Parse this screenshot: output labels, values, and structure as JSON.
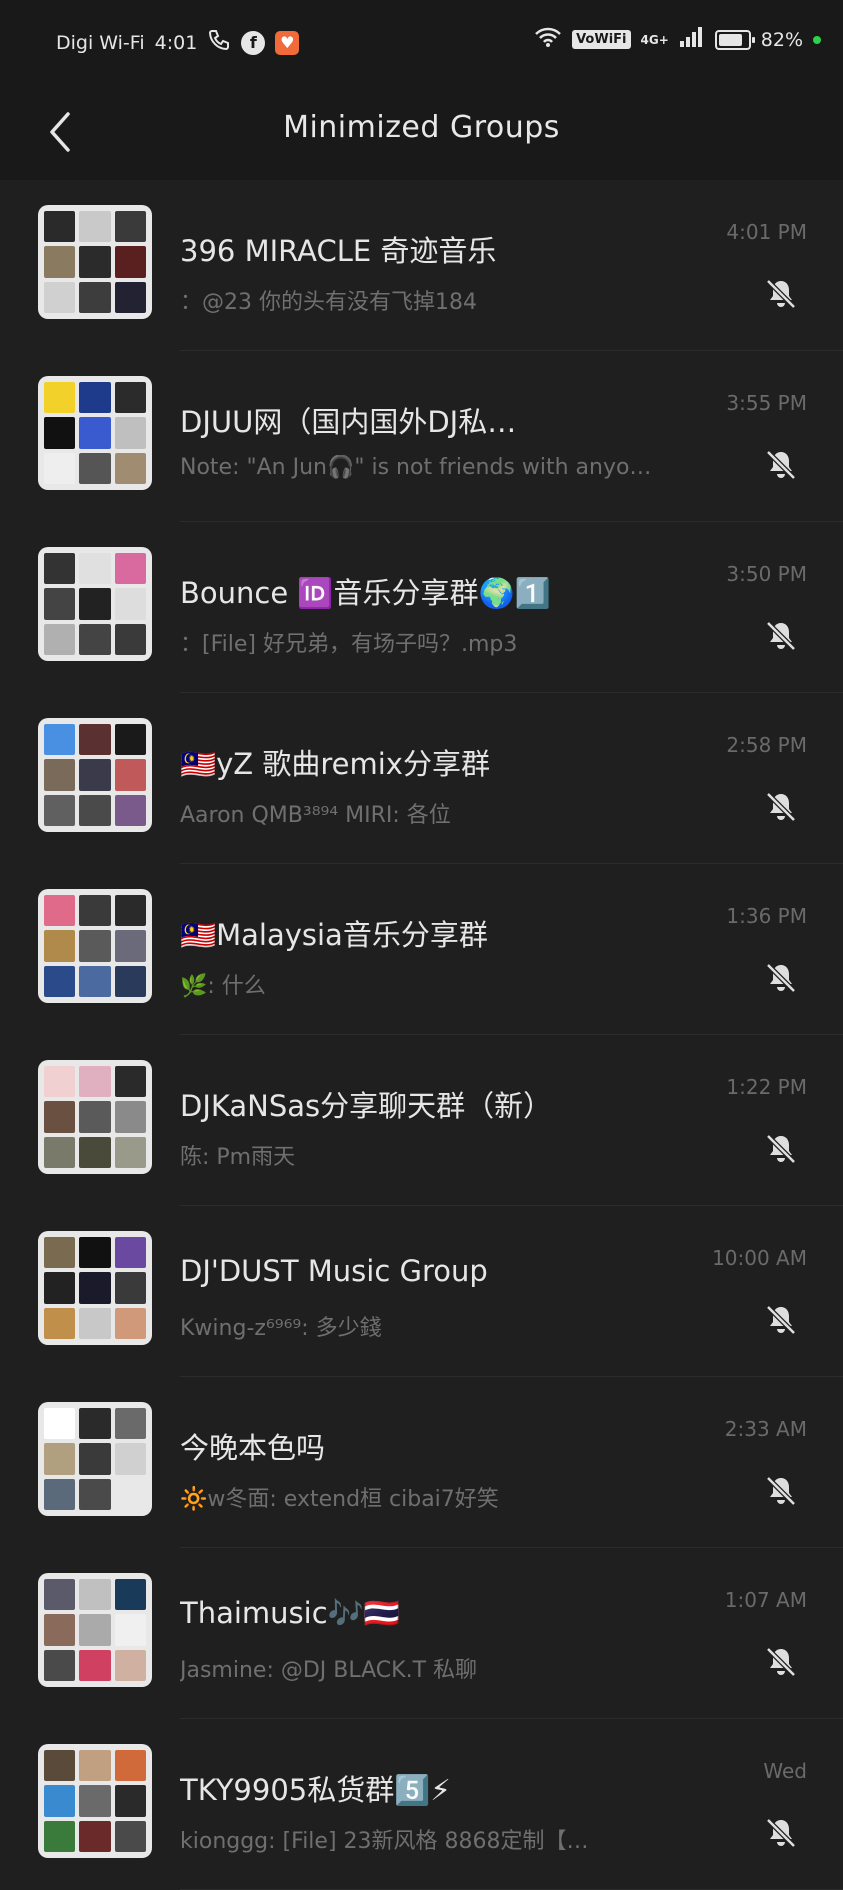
{
  "status_bar": {
    "carrier": "Digi Wi-Fi",
    "time": "4:01",
    "vowifi": "VoWiFi",
    "network": "4G+",
    "battery_percent": "82%",
    "battery_level": 0.82
  },
  "header": {
    "title": "Minimized Groups"
  },
  "groups": [
    {
      "name": "396 MIRACLE 奇迹音乐",
      "preview": "：@23 你的头有没有飞掉184",
      "time": "4:01 PM",
      "avatar_colors": [
        "#2a2a2a",
        "#c9c9c9",
        "#3a3a3a",
        "#8a7a60",
        "#2b2b2b",
        "#5a2020",
        "#d0d0d0",
        "#3d3d3d",
        "#222233"
      ]
    },
    {
      "name": "DJUU网（国内国外DJ私…",
      "preview": "Note: \"An Jun🎧\" is not friends with anyo…",
      "time": "3:55 PM",
      "avatar_colors": [
        "#f2d12a",
        "#1e3a8a",
        "#2b2b2b",
        "#111111",
        "#3a5bd0",
        "#bfbfbf",
        "#eeeeee",
        "#555555",
        "#a08c70"
      ]
    },
    {
      "name": "Bounce 🆔音乐分享群🌍1️⃣",
      "preview": "：[File] 好兄弟，有场子吗？.mp3",
      "time": "3:50 PM",
      "avatar_colors": [
        "#333333",
        "#e0e0e0",
        "#d86aa0",
        "#444444",
        "#222222",
        "#dddddd",
        "#b0b0b0",
        "#444444",
        "#3a3a3a"
      ]
    },
    {
      "name": "🇲🇾yZ 歌曲remix分享群",
      "preview": "Aaron QMB³⁸⁹⁴ MIRI: 各位",
      "time": "2:58 PM",
      "avatar_colors": [
        "#4a90e2",
        "#5a3030",
        "#1a1a1a",
        "#7a6a5a",
        "#3a3a4a",
        "#c05a5a",
        "#606060",
        "#4a4a4a",
        "#7a5a8a"
      ]
    },
    {
      "name": "🇲🇾Malaysia音乐分享群",
      "preview": "🌿: 什么",
      "time": "1:36 PM",
      "avatar_colors": [
        "#e06a8a",
        "#3a3a3a",
        "#2a2a2a",
        "#b08a4a",
        "#5a5a5a",
        "#6a6a7a",
        "#2a4a8a",
        "#4a6aa0",
        "#2a3a5a"
      ]
    },
    {
      "name": "DJKaNSas分享聊天群（新）",
      "preview": "陈: Pm雨天",
      "time": "1:22 PM",
      "avatar_colors": [
        "#f0d0d0",
        "#e0b0c0",
        "#2a2a2a",
        "#6a5040",
        "#5a5a5a",
        "#8a8a8a",
        "#7a7a6a",
        "#4a4a3a",
        "#9a9a8a"
      ]
    },
    {
      "name": "DJ'DUST Music Group",
      "preview": "Kwing-z⁶⁹⁶⁹: 多少錢",
      "time": "10:00 AM",
      "avatar_colors": [
        "#7a6a50",
        "#111111",
        "#6a4aa0",
        "#222222",
        "#1a1a2a",
        "#3a3a3a",
        "#c0904a",
        "#c8c8c8",
        "#d09a7a"
      ]
    },
    {
      "name": "今晚本色吗",
      "preview": "🔆w冬面: extend桓 cibai7好笑",
      "time": "2:33 AM",
      "avatar_colors": [
        "#ffffff",
        "#2a2a2a",
        "#6a6a6a",
        "#b0a080",
        "#3a3a3a",
        "#d0d0d0",
        "#5a6a7a",
        "#4a4a4a",
        "#e8e8e8"
      ]
    },
    {
      "name": "Thaimusic🎶🇹🇭",
      "preview": "Jasmine: @DJ BLACK.T 私聊",
      "time": "1:07 AM",
      "avatar_colors": [
        "#5a5a6a",
        "#c0c0c0",
        "#1a3a5a",
        "#8a6a5a",
        "#aaaaaa",
        "#f0f0f0",
        "#4a4a4a",
        "#d04060",
        "#d0b0a0"
      ]
    },
    {
      "name": "TKY9905私货群5️⃣⚡",
      "preview": "kionggg: [File] 23新风格 8868定制【…",
      "time": "Wed",
      "avatar_colors": [
        "#5a4a3a",
        "#c0a080",
        "#d06a3a",
        "#3a8ad0",
        "#6a6a6a",
        "#2a2a2a",
        "#3a7a3a",
        "#6a2a2a",
        "#4a4a4a"
      ]
    }
  ]
}
